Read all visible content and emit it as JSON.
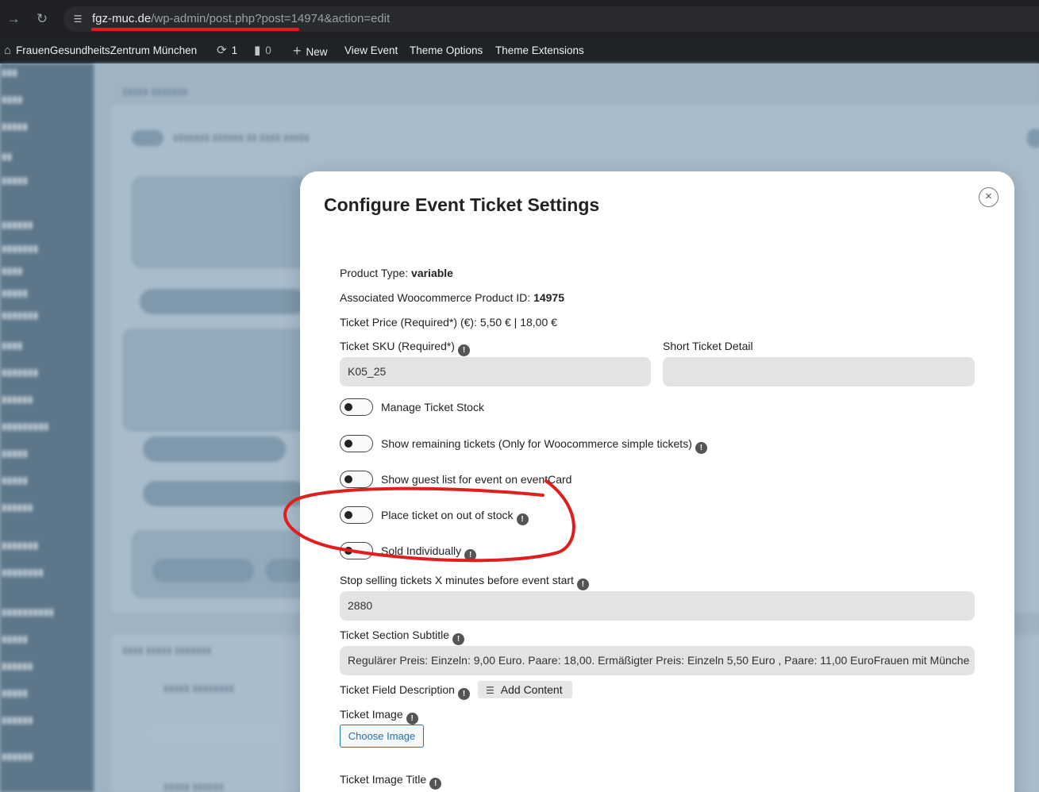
{
  "browser": {
    "url_host": "fgz-muc.de",
    "url_path": "/wp-admin/post.php?post=14974&action=edit",
    "back_icon": "arrow-right-icon",
    "reload_icon": "reload-icon",
    "site_settings_icon": "tune-icon"
  },
  "adminbar": {
    "site_name": "FrauenGesundheitsZentrum München",
    "updates_count": "1",
    "comments_count": "0",
    "new_label": "New",
    "view_event_label": "View Event",
    "theme_options_label": "Theme Options",
    "theme_extensions_label": "Theme Extensions"
  },
  "modal": {
    "title": "Configure Event Ticket Settings",
    "close_symbol": "×",
    "product_type_label": "Product Type:",
    "product_type_value": "variable",
    "product_id_label": "Associated Woocommerce Product ID:",
    "product_id_value": "14975",
    "ticket_price_text": "Ticket Price (Required*) (€): 5,50 € | 18,00 €",
    "sku_label": "Ticket SKU (Required*)",
    "sku_value": "K05_25",
    "short_detail_label": "Short Ticket Detail",
    "short_detail_value": "",
    "toggles": [
      {
        "label": "Manage Ticket Stock",
        "info": false
      },
      {
        "label": "Show remaining tickets (Only for Woocommerce simple tickets)",
        "info": true
      },
      {
        "label": "Show guest list for event on eventCard",
        "info": false
      },
      {
        "label": "Place ticket on out of stock",
        "info": true
      },
      {
        "label": "Sold Individually",
        "info": true
      }
    ],
    "stop_selling_label": "Stop selling tickets X minutes before event start",
    "stop_selling_value": "2880",
    "subtitle_label": "Ticket Section Subtitle",
    "subtitle_value": "Regulärer Preis: Einzeln: 9,00 Euro. Paare: 18,00. Ermäßigter Preis: Einzeln 5,50 Euro , Paare: 11,00 EuroFrauen mit Münche",
    "field_description_label": "Ticket Field Description",
    "add_content_label": "Add Content",
    "image_label": "Ticket Image",
    "choose_image_label": "Choose Image",
    "image_title_label": "Ticket Image Title",
    "info_symbol": "!"
  },
  "colors": {
    "annotation_red": "#e01e1e",
    "wp_blue": "#2271b1"
  }
}
